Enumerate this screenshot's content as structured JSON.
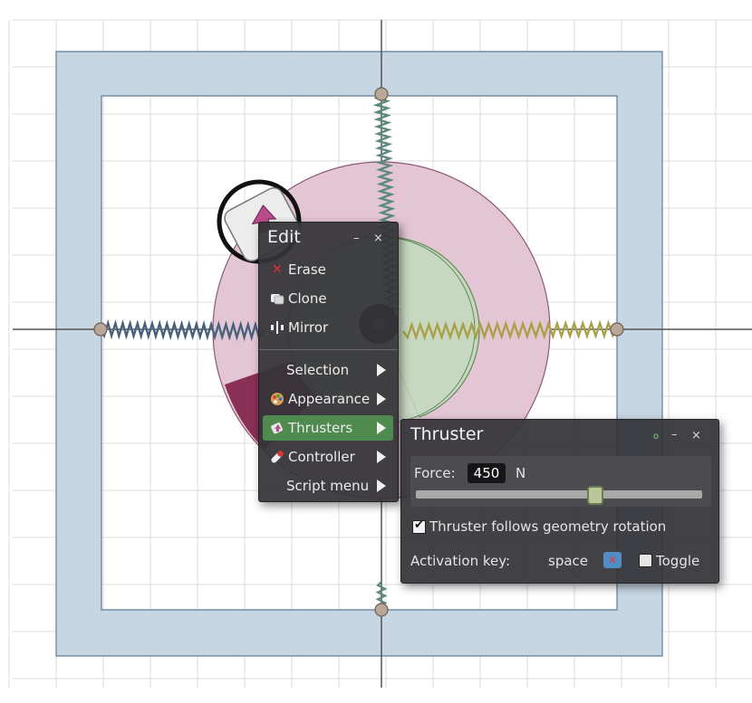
{
  "edit_menu": {
    "title": "Edit",
    "minimize": "–",
    "close": "×",
    "items": [
      {
        "label": "Erase",
        "icon": "cross-icon"
      },
      {
        "label": "Clone",
        "icon": "clone-icon"
      },
      {
        "label": "Mirror",
        "icon": "mirror-icon"
      },
      {
        "label": "Selection",
        "icon": ""
      },
      {
        "label": "Appearance",
        "icon": "palette-icon"
      },
      {
        "label": "Thrusters",
        "icon": "thruster-icon"
      },
      {
        "label": "Controller",
        "icon": "controller-icon"
      },
      {
        "label": "Script menu",
        "icon": ""
      }
    ],
    "active_item": "Thrusters"
  },
  "thruster_panel": {
    "title": "Thruster",
    "minimize": "–",
    "close": "×",
    "force_label": "Force:",
    "force_value": "450",
    "force_unit": "N",
    "force_slider_fraction": 0.62,
    "follows_rotation_label": "Thruster follows geometry rotation",
    "follows_rotation_checked": true,
    "activation_key_label": "Activation key:",
    "activation_key_value": "space",
    "toggle_label": "Toggle",
    "toggle_checked": false
  },
  "colors": {
    "frame_fill": "#c7d6e3",
    "disc_fill": "#e4c5d4",
    "disc_dark": "#8a2f56",
    "inner_fill": "#c7d8bf",
    "spring_blue": "#47627f",
    "spring_yellow": "#a9a14a",
    "spring_green": "#5d8a7f",
    "menu_active": "#4f8a4f",
    "thruster_icon_fill": "#b84d8a"
  }
}
